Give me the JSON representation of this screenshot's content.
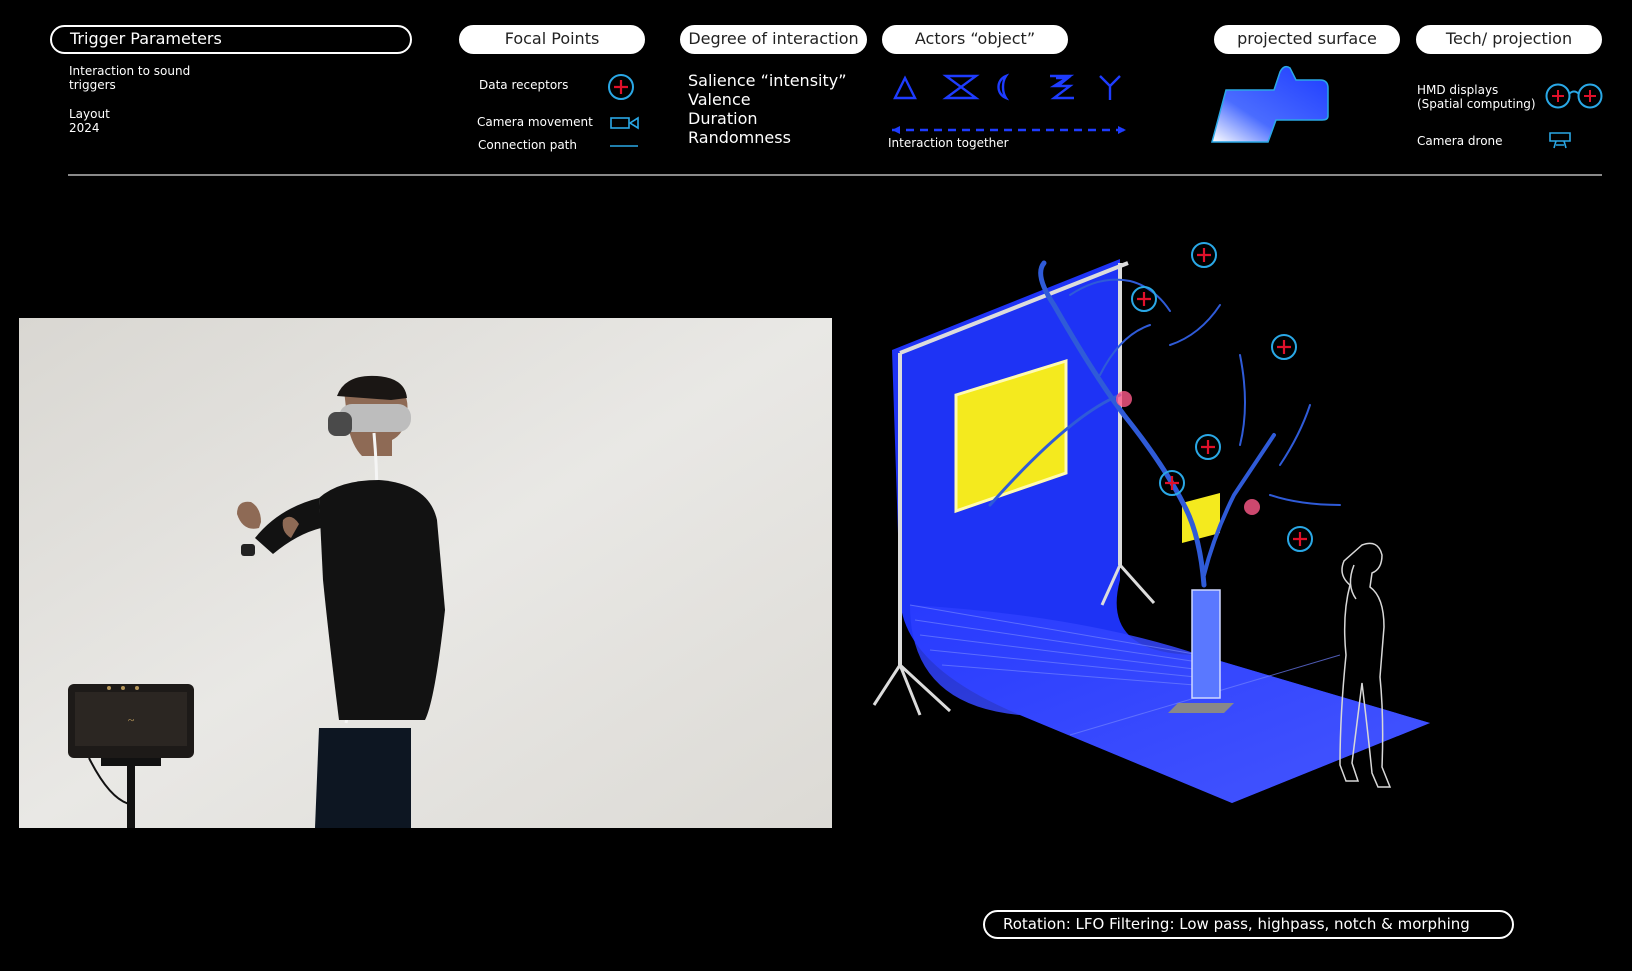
{
  "header": {
    "trigger_title": "Trigger Parameters",
    "trigger_desc": [
      "Interaction to sound",
      "triggers"
    ],
    "layout_label": [
      "Layout",
      "2024"
    ],
    "focal_title": "Focal Points",
    "focal_items": [
      "Data receptors",
      "Camera movement",
      "Connection path"
    ],
    "degree_title": "Degree of interaction",
    "degree_items": [
      "Salience “intensity”",
      "Valence",
      "Duration",
      "Randomness"
    ],
    "actors_title": "Actors “object”",
    "actors_caption": "Interaction together",
    "surface_title": "projected surface",
    "tech_title": "Tech/ projection",
    "tech_items": [
      "HMD displays",
      "(Spatial computing)",
      "Camera drone"
    ]
  },
  "footer": {
    "rotation_label": "Rotation: LFO Filtering: Low pass, highpass, notch & morphing"
  },
  "colors": {
    "accent_blue": "#1e3cff",
    "receptor_red": "#e0102a",
    "icon_cyan": "#2aa8e6",
    "highlight_yellow": "#f4ea1e"
  },
  "icons": [
    "plus-circle-icon",
    "camera-icon",
    "line-icon",
    "triangle-icon",
    "hourglass-icon",
    "crescent-icon",
    "double-s-icon",
    "fork-icon",
    "glasses-icon",
    "drone-icon"
  ]
}
